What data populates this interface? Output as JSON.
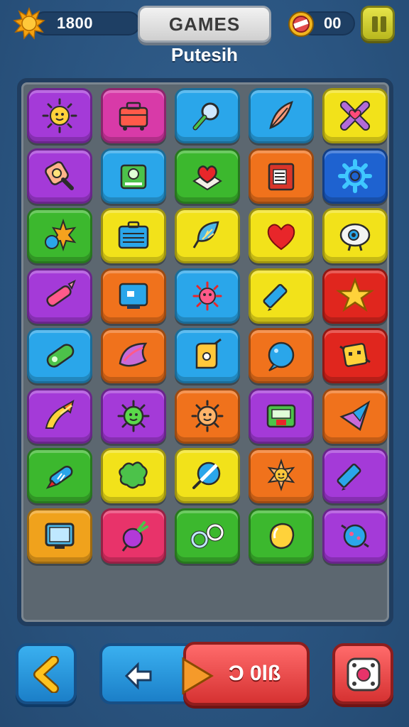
{
  "hud": {
    "coins": "1800",
    "gems": "00",
    "games_label": "GAMES",
    "coin_icon": "sun-icon",
    "gem_icon": "gem-coin-icon",
    "pause_icon": "pause-icon"
  },
  "page_title": "Putesih",
  "board": {
    "rows": [
      [
        {
          "color": "#a43ad8",
          "icon": "sun-face-icon"
        },
        {
          "color": "#d83aa8",
          "icon": "toolbox-icon"
        },
        {
          "color": "#2aa6ea",
          "icon": "magnifier-icon"
        },
        {
          "color": "#2aa6ea",
          "icon": "feather-icon"
        },
        {
          "color": "#f2e21a",
          "icon": "x-mark-icon"
        }
      ],
      [
        {
          "color": "#a43ad8",
          "icon": "frying-pan-icon"
        },
        {
          "color": "#2aa6ea",
          "icon": "camera-icon"
        },
        {
          "color": "#3cb82e",
          "icon": "heart-box-icon"
        },
        {
          "color": "#f0721c",
          "icon": "suitcase-icon"
        },
        {
          "color": "#1e62d0",
          "icon": "gear-icon"
        }
      ],
      [
        {
          "color": "#3cb82e",
          "icon": "spiky-creature-icon"
        },
        {
          "color": "#f2e21a",
          "icon": "briefcase-icon"
        },
        {
          "color": "#f2e21a",
          "icon": "leaf-icon"
        },
        {
          "color": "#f2e21a",
          "icon": "heart-icon"
        },
        {
          "color": "#f2e21a",
          "icon": "eye-robot-icon"
        }
      ],
      [
        {
          "color": "#a43ad8",
          "icon": "crayon-icon"
        },
        {
          "color": "#f0721c",
          "icon": "screen-icon"
        },
        {
          "color": "#2aa6ea",
          "icon": "virus-icon"
        },
        {
          "color": "#f2e21a",
          "icon": "pencil-icon"
        },
        {
          "color": "#e0261e",
          "icon": "star-icon"
        }
      ],
      [
        {
          "color": "#2aa6ea",
          "icon": "capsule-icon"
        },
        {
          "color": "#f0721c",
          "icon": "shell-icon"
        },
        {
          "color": "#2aa6ea",
          "icon": "scroll-icon"
        },
        {
          "color": "#f0721c",
          "icon": "bubble-icon"
        },
        {
          "color": "#e0261e",
          "icon": "robot-icon"
        }
      ],
      [
        {
          "color": "#a43ad8",
          "icon": "comet-icon"
        },
        {
          "color": "#a43ad8",
          "icon": "germ-icon"
        },
        {
          "color": "#f0721c",
          "icon": "sun-smile-icon"
        },
        {
          "color": "#a43ad8",
          "icon": "radio-icon"
        },
        {
          "color": "#f0721c",
          "icon": "gem-icon"
        }
      ],
      [
        {
          "color": "#3cb82e",
          "icon": "rocket-icon"
        },
        {
          "color": "#f2e21a",
          "icon": "splat-icon"
        },
        {
          "color": "#f2e21a",
          "icon": "ball-icon"
        },
        {
          "color": "#f0721c",
          "icon": "sun-star-icon"
        },
        {
          "color": "#a43ad8",
          "icon": "pencil-icon"
        }
      ],
      [
        {
          "color": "#f0a21c",
          "icon": "tv-icon"
        },
        {
          "color": "#e8336a",
          "icon": "beet-icon"
        },
        {
          "color": "#3cb82e",
          "icon": "handcuffs-icon"
        },
        {
          "color": "#3cb82e",
          "icon": "lemon-icon"
        },
        {
          "color": "#a43ad8",
          "icon": "planet-icon"
        }
      ]
    ]
  },
  "bottom": {
    "back_icon": "chevron-left-icon",
    "action_icons": [
      "swap-arrow-icon",
      "play-arrow-icon"
    ],
    "action_value": "Ͻ 0lß",
    "dice_icon": "dice-icon"
  }
}
